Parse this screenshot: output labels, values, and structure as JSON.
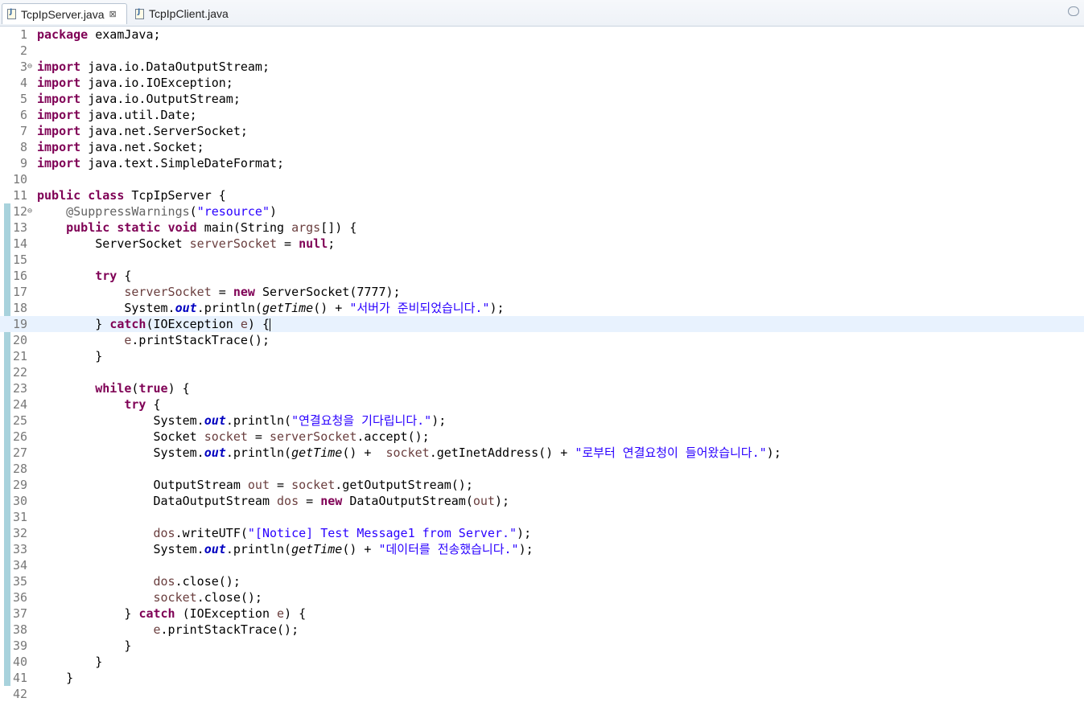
{
  "tabs": [
    {
      "label": "TcpIpServer.java",
      "active": true,
      "icon": "java-file-icon",
      "close": "⊠"
    },
    {
      "label": "TcpIpClient.java",
      "active": false,
      "icon": "java-file-icon"
    }
  ],
  "editor": {
    "current_line": 19,
    "lines": [
      [
        {
          "t": "package",
          "c": "k"
        },
        {
          "t": " examJava;"
        }
      ],
      [],
      [
        {
          "t": "import",
          "c": "k"
        },
        {
          "t": " java.io.DataOutputStream;"
        }
      ],
      [
        {
          "t": "import",
          "c": "k"
        },
        {
          "t": " java.io.IOException;"
        }
      ],
      [
        {
          "t": "import",
          "c": "k"
        },
        {
          "t": " java.io.OutputStream;"
        }
      ],
      [
        {
          "t": "import",
          "c": "k"
        },
        {
          "t": " java.util.Date;"
        }
      ],
      [
        {
          "t": "import",
          "c": "k"
        },
        {
          "t": " java.net.ServerSocket;"
        }
      ],
      [
        {
          "t": "import",
          "c": "k"
        },
        {
          "t": " java.net.Socket;"
        }
      ],
      [
        {
          "t": "import",
          "c": "k"
        },
        {
          "t": " java.text.SimpleDateFormat;"
        }
      ],
      [],
      [
        {
          "t": "public",
          "c": "k"
        },
        {
          "t": " "
        },
        {
          "t": "class",
          "c": "k"
        },
        {
          "t": " TcpIpServer {"
        }
      ],
      [
        {
          "t": "    "
        },
        {
          "t": "@SuppressWarnings",
          "c": "a"
        },
        {
          "t": "("
        },
        {
          "t": "\"resource\"",
          "c": "s"
        },
        {
          "t": ")"
        }
      ],
      [
        {
          "t": "    "
        },
        {
          "t": "public",
          "c": "k"
        },
        {
          "t": " "
        },
        {
          "t": "static",
          "c": "k"
        },
        {
          "t": " "
        },
        {
          "t": "void",
          "c": "k"
        },
        {
          "t": " main(String "
        },
        {
          "t": "args",
          "c": "v"
        },
        {
          "t": "[]) {"
        }
      ],
      [
        {
          "t": "        ServerSocket "
        },
        {
          "t": "serverSocket",
          "c": "v"
        },
        {
          "t": " = "
        },
        {
          "t": "null",
          "c": "k"
        },
        {
          "t": ";"
        }
      ],
      [],
      [
        {
          "t": "        "
        },
        {
          "t": "try",
          "c": "k"
        },
        {
          "t": " {"
        }
      ],
      [
        {
          "t": "            "
        },
        {
          "t": "serverSocket",
          "c": "v"
        },
        {
          "t": " = "
        },
        {
          "t": "new",
          "c": "k"
        },
        {
          "t": " ServerSocket(7777);"
        }
      ],
      [
        {
          "t": "            System."
        },
        {
          "t": "out",
          "c": "f"
        },
        {
          "t": ".println("
        },
        {
          "t": "getTime",
          "c": "m"
        },
        {
          "t": "() + "
        },
        {
          "t": "\"서버가 준비되었습니다.\"",
          "c": "s"
        },
        {
          "t": ");"
        }
      ],
      [
        {
          "t": "        } "
        },
        {
          "t": "catch",
          "c": "k"
        },
        {
          "t": "(IOException "
        },
        {
          "t": "e",
          "c": "v"
        },
        {
          "t": ") {"
        }
      ],
      [
        {
          "t": "            "
        },
        {
          "t": "e",
          "c": "v"
        },
        {
          "t": ".printStackTrace();"
        }
      ],
      [
        {
          "t": "        }"
        }
      ],
      [],
      [
        {
          "t": "        "
        },
        {
          "t": "while",
          "c": "k"
        },
        {
          "t": "("
        },
        {
          "t": "true",
          "c": "k"
        },
        {
          "t": ") {"
        }
      ],
      [
        {
          "t": "            "
        },
        {
          "t": "try",
          "c": "k"
        },
        {
          "t": " {"
        }
      ],
      [
        {
          "t": "                System."
        },
        {
          "t": "out",
          "c": "f"
        },
        {
          "t": ".println("
        },
        {
          "t": "\"연결요청을 기다립니다.\"",
          "c": "s"
        },
        {
          "t": ");"
        }
      ],
      [
        {
          "t": "                Socket "
        },
        {
          "t": "socket",
          "c": "v"
        },
        {
          "t": " = "
        },
        {
          "t": "serverSocket",
          "c": "v"
        },
        {
          "t": ".accept();"
        }
      ],
      [
        {
          "t": "                System."
        },
        {
          "t": "out",
          "c": "f"
        },
        {
          "t": ".println("
        },
        {
          "t": "getTime",
          "c": "m"
        },
        {
          "t": "() +  "
        },
        {
          "t": "socket",
          "c": "v"
        },
        {
          "t": ".getInetAddress() + "
        },
        {
          "t": "\"로부터 연결요청이 들어왔습니다.\"",
          "c": "s"
        },
        {
          "t": ");"
        }
      ],
      [],
      [
        {
          "t": "                OutputStream "
        },
        {
          "t": "out",
          "c": "v"
        },
        {
          "t": " = "
        },
        {
          "t": "socket",
          "c": "v"
        },
        {
          "t": ".getOutputStream();"
        }
      ],
      [
        {
          "t": "                DataOutputStream "
        },
        {
          "t": "dos",
          "c": "v"
        },
        {
          "t": " = "
        },
        {
          "t": "new",
          "c": "k"
        },
        {
          "t": " DataOutputStream("
        },
        {
          "t": "out",
          "c": "v"
        },
        {
          "t": ");"
        }
      ],
      [],
      [
        {
          "t": "                "
        },
        {
          "t": "dos",
          "c": "v"
        },
        {
          "t": ".writeUTF("
        },
        {
          "t": "\"[Notice] Test Message1 from Server.\"",
          "c": "s"
        },
        {
          "t": ");"
        }
      ],
      [
        {
          "t": "                System."
        },
        {
          "t": "out",
          "c": "f"
        },
        {
          "t": ".println("
        },
        {
          "t": "getTime",
          "c": "m"
        },
        {
          "t": "() + "
        },
        {
          "t": "\"데이터를 전송했습니다.\"",
          "c": "s"
        },
        {
          "t": ");"
        }
      ],
      [],
      [
        {
          "t": "                "
        },
        {
          "t": "dos",
          "c": "v"
        },
        {
          "t": ".close();"
        }
      ],
      [
        {
          "t": "                "
        },
        {
          "t": "socket",
          "c": "v"
        },
        {
          "t": ".close();"
        }
      ],
      [
        {
          "t": "            } "
        },
        {
          "t": "catch",
          "c": "k"
        },
        {
          "t": " (IOException "
        },
        {
          "t": "e",
          "c": "v"
        },
        {
          "t": ") {"
        }
      ],
      [
        {
          "t": "                "
        },
        {
          "t": "e",
          "c": "v"
        },
        {
          "t": ".printStackTrace();"
        }
      ],
      [
        {
          "t": "            }"
        }
      ],
      [
        {
          "t": "        }"
        }
      ],
      [
        {
          "t": "    }"
        }
      ],
      []
    ],
    "folds": {
      "3": "⊖",
      "12": "⊖"
    }
  }
}
